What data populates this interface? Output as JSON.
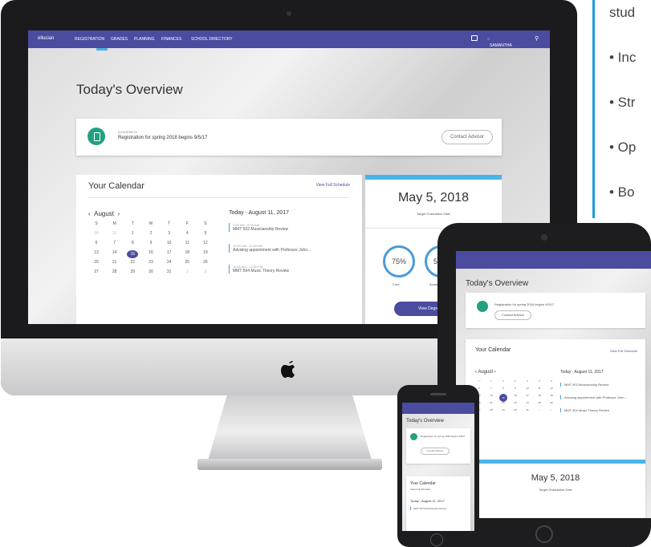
{
  "side_text": {
    "top": "stud",
    "bullets": [
      "• Inc",
      "• Str",
      "• Op",
      "• Bo"
    ]
  },
  "colors": {
    "nav": "#4b4ba0",
    "accent_blue": "#4ab3e6",
    "icon_green": "#22a082",
    "side_bar": "#1e9bd7"
  },
  "desktop": {
    "nav": {
      "logo": "ellucian",
      "items": [
        "Registration",
        "Grades",
        "Planning",
        "Finances",
        "School Directory"
      ],
      "user": "Samantha"
    },
    "title": "Today's Overview",
    "banner": {
      "category": "ACADEMICS",
      "message": "Registration for spring 2018 begins 9/5/17",
      "action": "Contact Advisor"
    },
    "calendar": {
      "heading": "Your Calendar",
      "link": "View Full Schedule",
      "month": "August",
      "weekdays": [
        "S",
        "M",
        "T",
        "W",
        "T",
        "F",
        "S"
      ],
      "weeks": [
        [
          "30",
          "31",
          "1",
          "2",
          "3",
          "4",
          "5"
        ],
        [
          "6",
          "7",
          "8",
          "9",
          "10",
          "11",
          "12"
        ],
        [
          "13",
          "14",
          "15",
          "16",
          "17",
          "18",
          "19"
        ],
        [
          "20",
          "21",
          "22",
          "23",
          "24",
          "25",
          "26"
        ],
        [
          "27",
          "28",
          "29",
          "30",
          "31",
          "1",
          "2"
        ]
      ],
      "day_heading": "Today - August 11, 2017",
      "events": [
        {
          "time": "7:00 AM - 8:00 AM",
          "title": "MMT 502 Musicianship Review"
        },
        {
          "time": "10:00 AM - 11:00 AM",
          "title": "Advising appointment with Professor John..."
        },
        {
          "time": "11:45 AM - 12:00 PM",
          "title": "MMT 504 Music Theory Review"
        }
      ]
    },
    "graduation": {
      "date": "May 5, 2018",
      "label": "Target Graduation Date",
      "rings": [
        {
          "value": "75%",
          "label": "Core"
        },
        {
          "value": "50%",
          "label": "Academic"
        }
      ],
      "button": "View Degree Progress"
    }
  },
  "tablet": {
    "title": "Today's Overview",
    "banner_message": "Registration for spring 2018 begins 9/5/17",
    "banner_action": "Contact Advisor",
    "calendar_heading": "Your Calendar",
    "calendar_link": "View Full Schedule",
    "month": "August",
    "day_heading": "Today - August 11, 2017",
    "events": [
      "MMT 502 Musicianship Review",
      "Advising appointment with Professor John...",
      "MMT 504 Music Theory Review"
    ],
    "grad_date": "May 5, 2018",
    "grad_label": "Target Graduation Date"
  },
  "phone": {
    "title": "Today's Overview",
    "banner_message": "Registration for spring 2018 begins 9/5/17",
    "banner_action": "Contact Advisor",
    "calendar_heading": "Your Calendar",
    "calendar_link": "View Full Schedule",
    "day_heading": "Today - August 11, 2017",
    "event": "MMT 502 Musicianship Review"
  }
}
